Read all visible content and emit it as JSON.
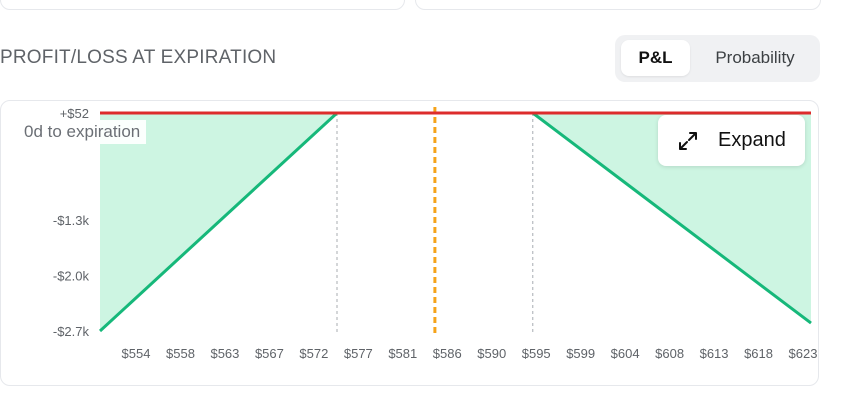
{
  "header": {
    "title": "PROFIT/LOSS AT EXPIRATION"
  },
  "view_toggle": {
    "options": [
      "P&L",
      "Probability"
    ],
    "selected": "P&L"
  },
  "chart_overlay": {
    "time_label": "0d to expiration",
    "expand_label": "Expand",
    "expand_icon": "expand-arrows-icon"
  },
  "colors": {
    "payoff_line": "#16b87a",
    "loss_fill": "#cdf5e2",
    "max_profit_line": "#dd2c2c",
    "current_price_line": "#f5a31a",
    "breakeven_line": "#a8acb2"
  },
  "chart_data": {
    "type": "line",
    "title": "",
    "xlabel": "",
    "ylabel": "",
    "x_ticks": [
      "$554",
      "$558",
      "$563",
      "$567",
      "$572",
      "$577",
      "$581",
      "$586",
      "$590",
      "$595",
      "$599",
      "$604",
      "$608",
      "$613",
      "$618",
      "$623"
    ],
    "y_ticks": [
      "+$52",
      "-$1.3k",
      "-$2.0k",
      "-$2.7k"
    ],
    "xlim": [
      554,
      623
    ],
    "ylim": [
      -2700,
      52
    ],
    "series": [
      {
        "x": [
          554,
          577,
          596,
          623
        ],
        "y": [
          -2700,
          52,
          52,
          -2600
        ]
      }
    ],
    "max_profit": 52,
    "breakevens": [
      577,
      596
    ],
    "current_price": 586.5,
    "grid": false
  }
}
